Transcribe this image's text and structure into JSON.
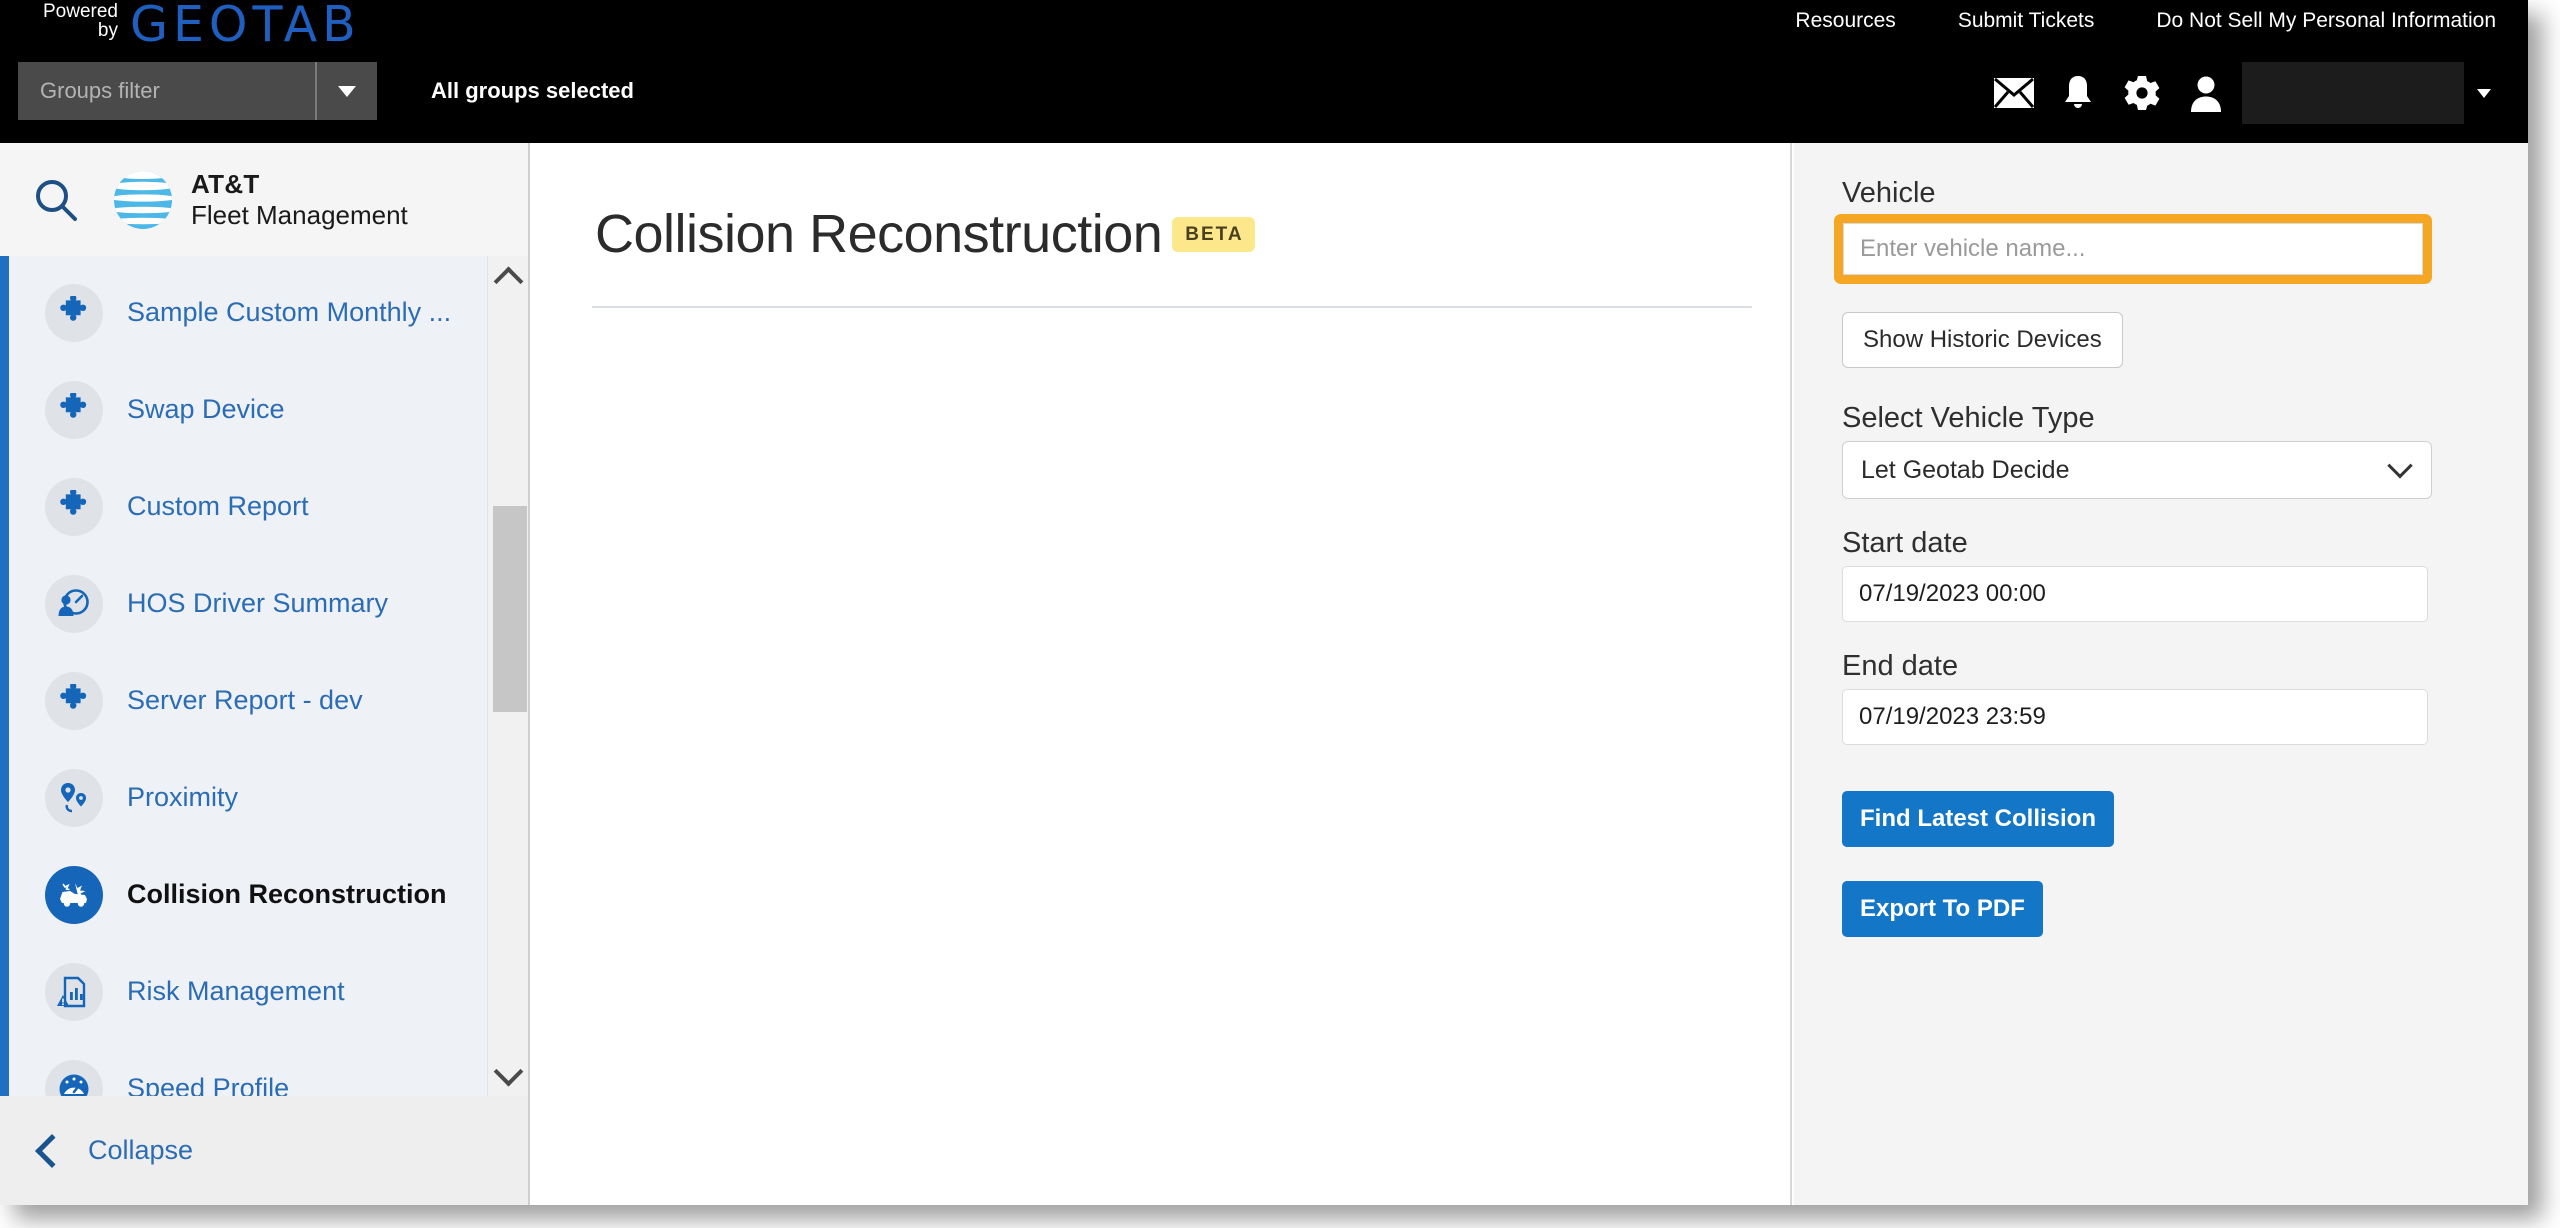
{
  "topbar": {
    "powered_line1": "Powered",
    "powered_line2": "by",
    "logo": "GEOTAB",
    "links": [
      {
        "label": "Resources"
      },
      {
        "label": "Submit Tickets"
      },
      {
        "label": "Do Not Sell My Personal Information"
      }
    ],
    "groups_filter_placeholder": "Groups filter",
    "groups_status": "All groups selected",
    "icons": [
      {
        "name": "mail-icon"
      },
      {
        "name": "bell-icon"
      },
      {
        "name": "gear-icon"
      },
      {
        "name": "user-icon"
      }
    ],
    "user_name": ""
  },
  "sidebar": {
    "search_icon": "search-icon",
    "brand_line1": "AT&T",
    "brand_line2": "Fleet Management",
    "items": [
      {
        "label": "Sample Custom Monthly ...",
        "icon": "puzzle-piece-icon",
        "active": false
      },
      {
        "label": "Swap Device",
        "icon": "puzzle-piece-icon",
        "active": false
      },
      {
        "label": "Custom Report",
        "icon": "puzzle-piece-icon",
        "active": false
      },
      {
        "label": "HOS Driver Summary",
        "icon": "driver-gauge-icon",
        "active": false
      },
      {
        "label": "Server Report - dev",
        "icon": "puzzle-piece-icon",
        "active": false
      },
      {
        "label": "Proximity",
        "icon": "proximity-icon",
        "active": false
      },
      {
        "label": "Collision Reconstruction",
        "icon": "collision-car-icon",
        "active": true
      },
      {
        "label": "Risk Management",
        "icon": "risk-document-icon",
        "active": false
      },
      {
        "label": "Speed Profile",
        "icon": "speedometer-icon",
        "active": false
      }
    ],
    "collapse_label": "Collapse"
  },
  "main": {
    "title": "Collision Reconstruction",
    "badge": "BETA"
  },
  "panel": {
    "vehicle_label": "Vehicle",
    "vehicle_value": "",
    "vehicle_placeholder": "Enter vehicle name...",
    "show_historic_label": "Show Historic Devices",
    "vehicle_type_label": "Select Vehicle Type",
    "vehicle_type_value": "Let Geotab Decide",
    "start_date_label": "Start date",
    "start_date_value": "07/19/2023 00:00",
    "end_date_label": "End date",
    "end_date_value": "07/19/2023 23:59",
    "find_collision_label": "Find Latest Collision",
    "export_pdf_label": "Export To PDF"
  },
  "colors": {
    "brand_blue": "#1476c6",
    "sidebar_accent": "#1f6fc4",
    "highlight_orange": "#f5a623",
    "beta_yellow": "#fce88b",
    "geotab_blue": "#1f5fbf"
  }
}
